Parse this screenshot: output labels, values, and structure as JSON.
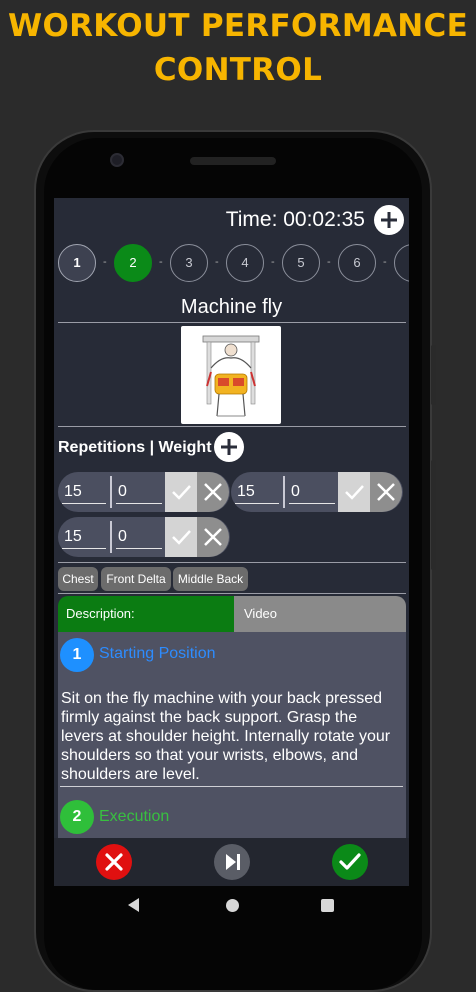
{
  "promo": {
    "line1": "WORKOUT PERFORMANCE",
    "line2": "CONTROL"
  },
  "header": {
    "time_label": "Time: 00:02:35",
    "add_icon": "plus-icon"
  },
  "sets": [
    "1",
    "2",
    "3",
    "4",
    "5",
    "6"
  ],
  "exercise": {
    "name": "Machine fly",
    "image_icon": "machine-fly-illustration"
  },
  "reps": {
    "heading": "Repetitions | Weight",
    "rows": [
      {
        "reps": "15",
        "weight": "0"
      },
      {
        "reps": "15",
        "weight": "0"
      },
      {
        "reps": "15",
        "weight": "0"
      }
    ]
  },
  "muscles": [
    "Chest",
    "Front Delta",
    "Middle Back"
  ],
  "tabs": {
    "description": "Description:",
    "video": "Video"
  },
  "steps": [
    {
      "number": "1",
      "title": "Starting Position",
      "text": "Sit on the fly machine with your back pressed firmly against the back support. Grasp the levers at shoulder height. Internally rotate your shoulders so that your wrists, elbows, and shoulders are level.",
      "color": "#1e90ff"
    },
    {
      "number": "2",
      "title": "Execution",
      "color": "#2fbf3a"
    }
  ],
  "bottom_actions": {
    "cancel_icon": "close-icon",
    "skip_icon": "skip-next-icon",
    "finish_icon": "check-icon"
  },
  "colors": {
    "promo": "#f7b500",
    "active_set": "#0b8a18",
    "description_tab": "#0b7c12",
    "cancel": "#e01010",
    "finish": "#0b8a18"
  }
}
